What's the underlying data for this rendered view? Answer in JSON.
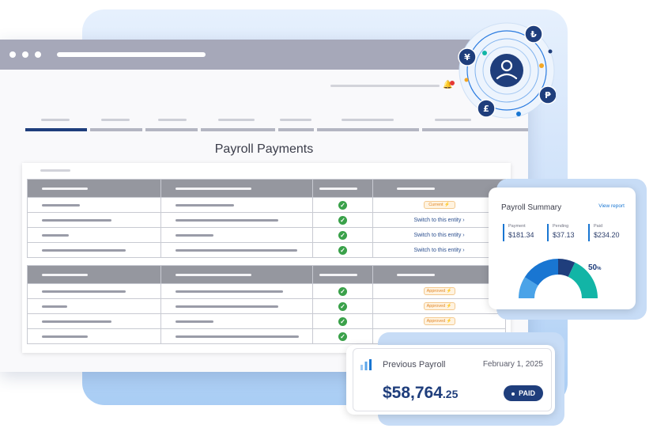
{
  "page": {
    "title": "Payroll Payments"
  },
  "table_1": {
    "rows": [
      {
        "status": "ok",
        "action_type": "pill",
        "action": "Current ⚡"
      },
      {
        "status": "ok",
        "action_type": "link",
        "action": "Switch to this entity ›"
      },
      {
        "status": "ok",
        "action_type": "link",
        "action": "Switch to this entity ›"
      },
      {
        "status": "ok",
        "action_type": "link",
        "action": "Switch to this entity ›"
      }
    ]
  },
  "table_2": {
    "rows": [
      {
        "status": "ok",
        "action_type": "pill",
        "action": "Approved ⚡"
      },
      {
        "status": "ok",
        "action_type": "pill",
        "action": "Approved ⚡"
      },
      {
        "status": "ok",
        "action_type": "pill",
        "action": "Approved ⚡"
      },
      {
        "status": "ok",
        "action_type": "none",
        "action": ""
      }
    ]
  },
  "summary": {
    "title": "Payroll Summary",
    "link": "View report",
    "stats": [
      {
        "label": "Payment",
        "value": "$181.34"
      },
      {
        "label": "Pending",
        "value": "$37.13"
      },
      {
        "label": "Paid",
        "value": "$234.20"
      }
    ],
    "percent": "50",
    "percent_sign": "%",
    "gauge_fraction": 0.5
  },
  "previous": {
    "title": "Previous Payroll",
    "date": "February 1, 2025",
    "amount_main": "$58,764",
    "amount_cents": ".25",
    "badge": "PAID"
  },
  "currency_icons": [
    "₺",
    "¥",
    "₱",
    "£"
  ],
  "colors": {
    "navy": "#1f3e7c",
    "success": "#3aa14a",
    "warning": "#e2882a",
    "link": "#1976d2",
    "gauge_teal": "#12b5a6",
    "gauge_blue": "#1976d2",
    "gauge_light": "#4aa3e8"
  }
}
